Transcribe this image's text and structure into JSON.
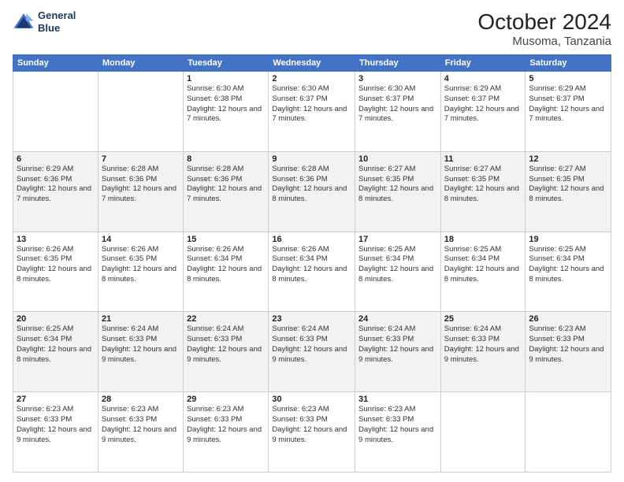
{
  "logo": {
    "line1": "General",
    "line2": "Blue"
  },
  "header": {
    "month": "October 2024",
    "location": "Musoma, Tanzania"
  },
  "weekdays": [
    "Sunday",
    "Monday",
    "Tuesday",
    "Wednesday",
    "Thursday",
    "Friday",
    "Saturday"
  ],
  "rows": [
    [
      {
        "day": "",
        "detail": ""
      },
      {
        "day": "",
        "detail": ""
      },
      {
        "day": "1",
        "detail": "Sunrise: 6:30 AM\nSunset: 6:38 PM\nDaylight: 12 hours\nand 7 minutes."
      },
      {
        "day": "2",
        "detail": "Sunrise: 6:30 AM\nSunset: 6:37 PM\nDaylight: 12 hours\nand 7 minutes."
      },
      {
        "day": "3",
        "detail": "Sunrise: 6:30 AM\nSunset: 6:37 PM\nDaylight: 12 hours\nand 7 minutes."
      },
      {
        "day": "4",
        "detail": "Sunrise: 6:29 AM\nSunset: 6:37 PM\nDaylight: 12 hours\nand 7 minutes."
      },
      {
        "day": "5",
        "detail": "Sunrise: 6:29 AM\nSunset: 6:37 PM\nDaylight: 12 hours\nand 7 minutes."
      }
    ],
    [
      {
        "day": "6",
        "detail": "Sunrise: 6:29 AM\nSunset: 6:36 PM\nDaylight: 12 hours\nand 7 minutes."
      },
      {
        "day": "7",
        "detail": "Sunrise: 6:28 AM\nSunset: 6:36 PM\nDaylight: 12 hours\nand 7 minutes."
      },
      {
        "day": "8",
        "detail": "Sunrise: 6:28 AM\nSunset: 6:36 PM\nDaylight: 12 hours\nand 7 minutes."
      },
      {
        "day": "9",
        "detail": "Sunrise: 6:28 AM\nSunset: 6:36 PM\nDaylight: 12 hours\nand 8 minutes."
      },
      {
        "day": "10",
        "detail": "Sunrise: 6:27 AM\nSunset: 6:35 PM\nDaylight: 12 hours\nand 8 minutes."
      },
      {
        "day": "11",
        "detail": "Sunrise: 6:27 AM\nSunset: 6:35 PM\nDaylight: 12 hours\nand 8 minutes."
      },
      {
        "day": "12",
        "detail": "Sunrise: 6:27 AM\nSunset: 6:35 PM\nDaylight: 12 hours\nand 8 minutes."
      }
    ],
    [
      {
        "day": "13",
        "detail": "Sunrise: 6:26 AM\nSunset: 6:35 PM\nDaylight: 12 hours\nand 8 minutes."
      },
      {
        "day": "14",
        "detail": "Sunrise: 6:26 AM\nSunset: 6:35 PM\nDaylight: 12 hours\nand 8 minutes."
      },
      {
        "day": "15",
        "detail": "Sunrise: 6:26 AM\nSunset: 6:34 PM\nDaylight: 12 hours\nand 8 minutes."
      },
      {
        "day": "16",
        "detail": "Sunrise: 6:26 AM\nSunset: 6:34 PM\nDaylight: 12 hours\nand 8 minutes."
      },
      {
        "day": "17",
        "detail": "Sunrise: 6:25 AM\nSunset: 6:34 PM\nDaylight: 12 hours\nand 8 minutes."
      },
      {
        "day": "18",
        "detail": "Sunrise: 6:25 AM\nSunset: 6:34 PM\nDaylight: 12 hours\nand 8 minutes."
      },
      {
        "day": "19",
        "detail": "Sunrise: 6:25 AM\nSunset: 6:34 PM\nDaylight: 12 hours\nand 8 minutes."
      }
    ],
    [
      {
        "day": "20",
        "detail": "Sunrise: 6:25 AM\nSunset: 6:34 PM\nDaylight: 12 hours\nand 8 minutes."
      },
      {
        "day": "21",
        "detail": "Sunrise: 6:24 AM\nSunset: 6:33 PM\nDaylight: 12 hours\nand 9 minutes."
      },
      {
        "day": "22",
        "detail": "Sunrise: 6:24 AM\nSunset: 6:33 PM\nDaylight: 12 hours\nand 9 minutes."
      },
      {
        "day": "23",
        "detail": "Sunrise: 6:24 AM\nSunset: 6:33 PM\nDaylight: 12 hours\nand 9 minutes."
      },
      {
        "day": "24",
        "detail": "Sunrise: 6:24 AM\nSunset: 6:33 PM\nDaylight: 12 hours\nand 9 minutes."
      },
      {
        "day": "25",
        "detail": "Sunrise: 6:24 AM\nSunset: 6:33 PM\nDaylight: 12 hours\nand 9 minutes."
      },
      {
        "day": "26",
        "detail": "Sunrise: 6:23 AM\nSunset: 6:33 PM\nDaylight: 12 hours\nand 9 minutes."
      }
    ],
    [
      {
        "day": "27",
        "detail": "Sunrise: 6:23 AM\nSunset: 6:33 PM\nDaylight: 12 hours\nand 9 minutes."
      },
      {
        "day": "28",
        "detail": "Sunrise: 6:23 AM\nSunset: 6:33 PM\nDaylight: 12 hours\nand 9 minutes."
      },
      {
        "day": "29",
        "detail": "Sunrise: 6:23 AM\nSunset: 6:33 PM\nDaylight: 12 hours\nand 9 minutes."
      },
      {
        "day": "30",
        "detail": "Sunrise: 6:23 AM\nSunset: 6:33 PM\nDaylight: 12 hours\nand 9 minutes."
      },
      {
        "day": "31",
        "detail": "Sunrise: 6:23 AM\nSunset: 6:33 PM\nDaylight: 12 hours\nand 9 minutes."
      },
      {
        "day": "",
        "detail": ""
      },
      {
        "day": "",
        "detail": ""
      }
    ]
  ]
}
